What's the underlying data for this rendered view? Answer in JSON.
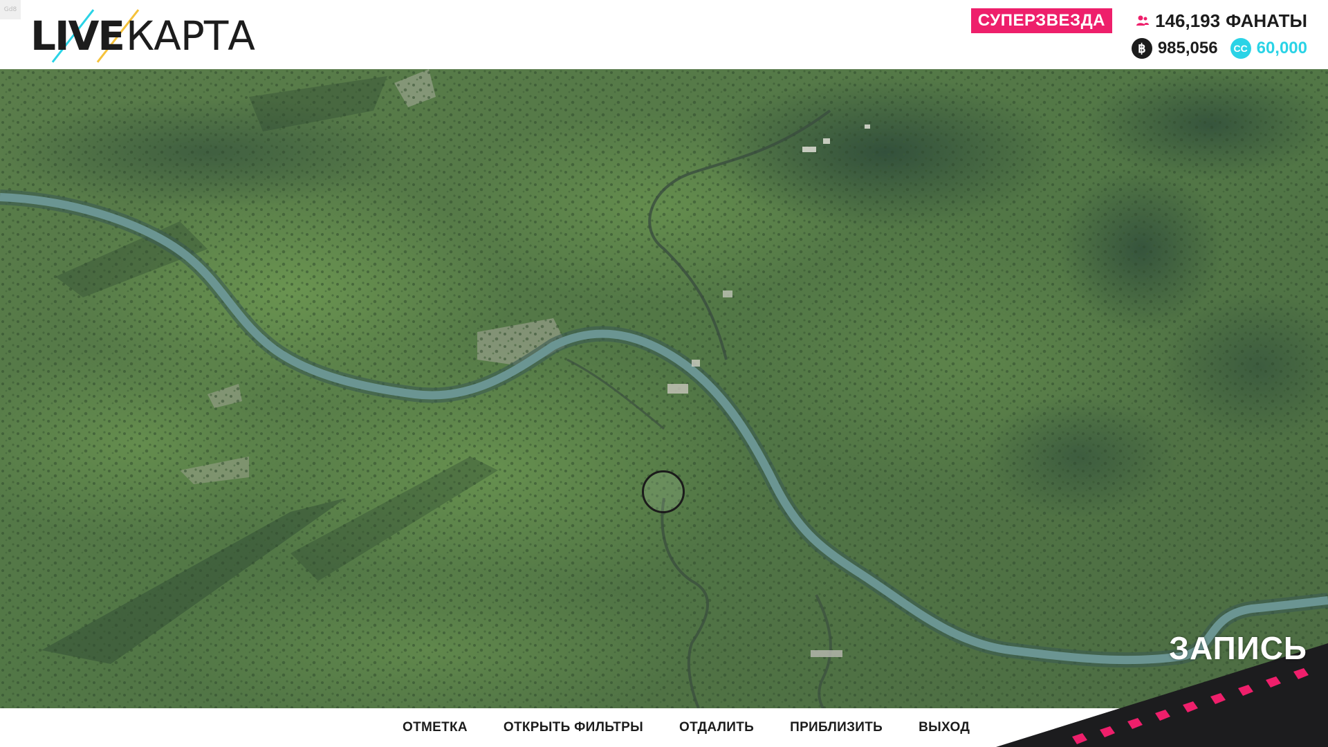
{
  "corner_tag": "Gd8",
  "logo": {
    "part1": "LIVE",
    "part2": "КАРТА"
  },
  "status": {
    "rank": "СУПЕРЗВЕЗДА",
    "fans_count": "146,193",
    "fans_label": "ФАНАТЫ",
    "credits": "985,056",
    "cc_icon_text": "CC",
    "cc_value": "60,000"
  },
  "record": {
    "label": "ЗАПИСЬ"
  },
  "controls": {
    "mark": "ОТМЕТКА",
    "filters": "ОТКРЫТЬ ФИЛЬТРЫ",
    "zoom_out": "ОТДАЛИТЬ",
    "zoom_in": "ПРИБЛИЗИТЬ",
    "exit": "ВЫХОД"
  },
  "colors": {
    "accent_pink": "#ee1f6b",
    "accent_cyan": "#2ad3e6",
    "accent_yellow": "#f5c23b",
    "terrain": "#4e7043",
    "river": "#5f8b88"
  },
  "icons": {
    "fans": "person-icon",
    "credits": "coin-icon",
    "cc": "cc-icon"
  }
}
